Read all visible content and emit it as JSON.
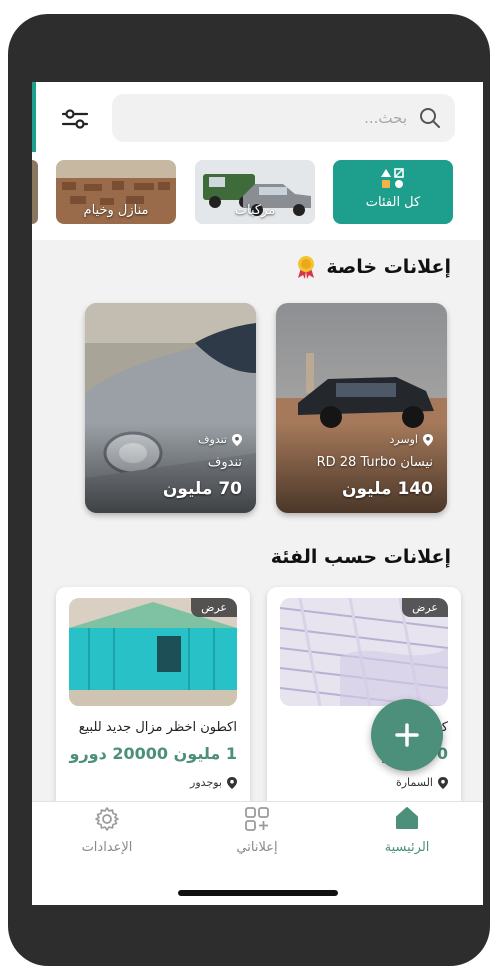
{
  "search": {
    "placeholder": "بحث..."
  },
  "categories": [
    {
      "label": "كل الفئات",
      "selected": true
    },
    {
      "label": "مركبات"
    },
    {
      "label": "منازل وخيام"
    }
  ],
  "featured": {
    "title": "إعلانات خاصة",
    "items": [
      {
        "location": "اوسرد",
        "name": "نيسان RD 28 Turbo",
        "price": "140 مليون"
      },
      {
        "location": "تندوف",
        "name": "تندوف",
        "price": "70 مليون"
      }
    ]
  },
  "by_category": {
    "title": "إعلانات حسب الفئة",
    "items": [
      {
        "badge": "عرض",
        "title": "كموند",
        "price": "00 دورو",
        "location": "السمارة"
      },
      {
        "badge": "عرض",
        "title": "اكطون اخظر مزال جديد للبيع",
        "price": "1 مليون 20000 دورو",
        "location": "بوجدور"
      }
    ]
  },
  "nav": {
    "home": "الرئيسية",
    "my_ads": "إعلاناتي",
    "settings": "الإعدادات"
  },
  "colors": {
    "accent": "#4c8f7a",
    "teal_card": "#1e9e8c"
  }
}
